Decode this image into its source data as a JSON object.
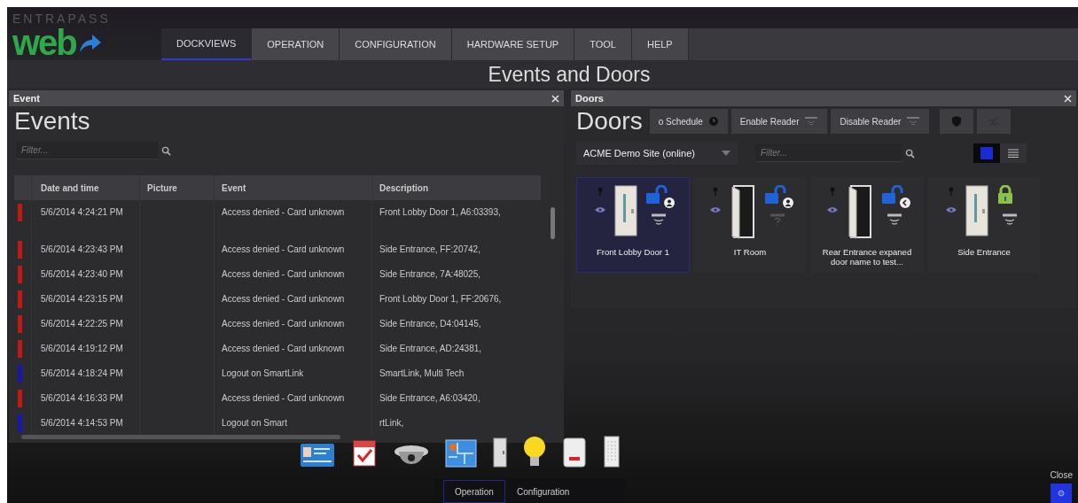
{
  "logo": {
    "small": "ENTRAPASS",
    "big": "web"
  },
  "menu": [
    {
      "label": "DOCKVIEWS",
      "selected": true
    },
    {
      "label": "OPERATION",
      "selected": false
    },
    {
      "label": "CONFIGURATION",
      "selected": false
    },
    {
      "label": "HARDWARE SETUP",
      "selected": false
    },
    {
      "label": "TOOL",
      "selected": false
    },
    {
      "label": "HELP",
      "selected": false
    }
  ],
  "page_title": "Events and Doors",
  "events_panel": {
    "caption": "Event",
    "heading": "Events",
    "filter_placeholder": "Filter...",
    "columns": [
      "Date and time",
      "Picture",
      "Event",
      "Description"
    ],
    "rows": [
      {
        "color": "#c01818",
        "date": "5/6/2014 4:24:21 PM",
        "event": "Access denied - Card unknown",
        "description": "Front Lobby Door 1, A6:03393,"
      },
      {
        "color": "#c01818",
        "date": "5/6/2014 4:23:43 PM",
        "event": "Access denied - Card unknown",
        "description": "Side Entrance, FF:20742,"
      },
      {
        "color": "#c01818",
        "date": "5/6/2014 4:23:40 PM",
        "event": "Access denied - Card unknown",
        "description": "Side Entrance, 7A:48025,"
      },
      {
        "color": "#c01818",
        "date": "5/6/2014 4:23:15 PM",
        "event": "Access denied - Card unknown",
        "description": "Front Lobby Door 1, FF:20676,"
      },
      {
        "color": "#c01818",
        "date": "5/6/2014 4:22:25 PM",
        "event": "Access denied - Card unknown",
        "description": "Side Entrance, D4:04145,"
      },
      {
        "color": "#c01818",
        "date": "5/6/2014 4:19:12 PM",
        "event": "Access denied - Card unknown",
        "description": "Side Entrance, AD:24381,"
      },
      {
        "color": "#1818b0",
        "date": "5/6/2014 4:18:24 PM",
        "event": "Logout on SmartLink",
        "description": "SmartLink, Multi Tech"
      },
      {
        "color": "#c01818",
        "date": "5/6/2014 4:16:33 PM",
        "event": "Access denied - Card unknown",
        "description": "Side Entrance, A6:03420,"
      },
      {
        "color": "#1818b0",
        "date": "5/6/2014 4:14:53 PM",
        "event": "Logout on Smart",
        "description": "rtLink,"
      }
    ]
  },
  "doors_panel": {
    "caption": "Doors",
    "heading": "Doors",
    "actions": [
      "o Schedule",
      "Enable Reader",
      "Disable Reader"
    ],
    "site": "ACME Demo Site (online)",
    "filter_placeholder": "Filter...",
    "views": [
      {
        "kind": "grid",
        "selected": true
      },
      {
        "kind": "list",
        "selected": false
      }
    ],
    "doors": [
      {
        "name": "Front Lobby Door 1",
        "selected": true,
        "open": false,
        "locked": false,
        "user_badge": true,
        "return_badge": false,
        "reader_fault": false
      },
      {
        "name": "IT Room",
        "selected": false,
        "open": true,
        "locked": false,
        "user_badge": true,
        "return_badge": false,
        "reader_fault": true
      },
      {
        "name": "Rear Entrance expaned door name to test...",
        "selected": false,
        "open": true,
        "locked": false,
        "user_badge": false,
        "return_badge": true,
        "reader_fault": false
      },
      {
        "name": "Side Entrance",
        "selected": false,
        "open": false,
        "locked": true,
        "user_badge": false,
        "return_badge": false,
        "reader_fault": false
      }
    ]
  },
  "bottom_tabs": [
    {
      "label": "Operation",
      "selected": true
    },
    {
      "label": "Configuration",
      "selected": false
    }
  ],
  "close_label": "Close"
}
